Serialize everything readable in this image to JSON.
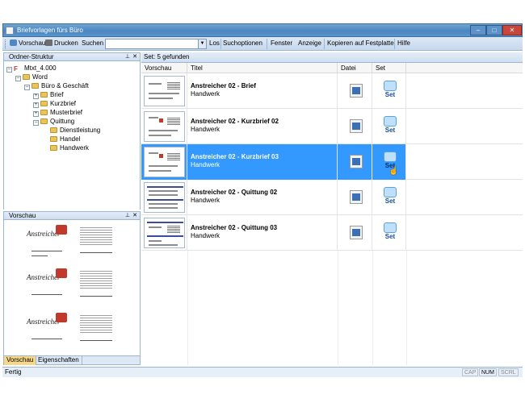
{
  "window": {
    "title": "Briefvorlagen fürs Büro",
    "ghost_title": "",
    "minimize": "–",
    "maximize": "□",
    "close": "✕"
  },
  "toolbar": {
    "preview_label": "Vorschau",
    "print_label": "Drucken",
    "search_label": "Suchen",
    "search_value": "",
    "go_label": "Los",
    "search_options_label": "Suchoptionen",
    "window_label": "Fenster",
    "view_label": "Anzeige",
    "copy_label": "Kopieren auf Festplatte",
    "help_label": "Hilfe"
  },
  "folder_panel": {
    "title": "Ordner-Struktur",
    "pin": "📌",
    "close": "✕",
    "items": [
      {
        "label": "Mtxt_4.000",
        "expander": "–",
        "level": 0
      },
      {
        "label": "Word",
        "expander": "–",
        "level": 1
      },
      {
        "label": "Büro & Geschäft",
        "expander": "–",
        "level": 2
      },
      {
        "label": "Brief",
        "expander": "+",
        "level": 3
      },
      {
        "label": "Kurzbrief",
        "expander": "+",
        "level": 3
      },
      {
        "label": "Musterbrief",
        "expander": "+",
        "level": 3
      },
      {
        "label": "Quittung",
        "expander": "–",
        "level": 3
      },
      {
        "label": "Dienstleistung",
        "expander": "",
        "level": 4
      },
      {
        "label": "Handel",
        "expander": "",
        "level": 4
      },
      {
        "label": "Handwerk",
        "expander": "",
        "level": 4
      }
    ]
  },
  "preview_panel": {
    "title": "Vorschau",
    "pin": "📌",
    "close": "✕",
    "logo_text": "Anstreicher"
  },
  "bottom_tabs": {
    "preview": "Vorschau",
    "properties": "Eigenschaften"
  },
  "results": {
    "header": "Set: 5 gefunden",
    "columns": {
      "preview": "Vorschau",
      "title": "Titel",
      "file": "Datei",
      "set": "Set"
    },
    "rows": [
      {
        "title": "Anstreicher 02 - Brief",
        "category": "Handwerk",
        "set_label": "Set",
        "selected": false
      },
      {
        "title": "Anstreicher 02 - Kurzbrief 02",
        "category": "Handwerk",
        "set_label": "Set",
        "selected": false
      },
      {
        "title": "Anstreicher 02 - Kurzbrief 03",
        "category": "Handwerk",
        "set_label": "Set",
        "selected": true
      },
      {
        "title": "Anstreicher 02 - Quittung 02",
        "category": "Handwerk",
        "set_label": "Set",
        "selected": false
      },
      {
        "title": "Anstreicher 02 - Quittung 03",
        "category": "Handwerk",
        "set_label": "Set",
        "selected": false
      }
    ]
  },
  "status": {
    "text": "Fertig",
    "cap": "CAP",
    "num": "NUM",
    "scrl": "SCRL"
  },
  "colors": {
    "selection": "#3399ff",
    "titlebar": "#4a86c0",
    "close_button": "#c8463a"
  }
}
